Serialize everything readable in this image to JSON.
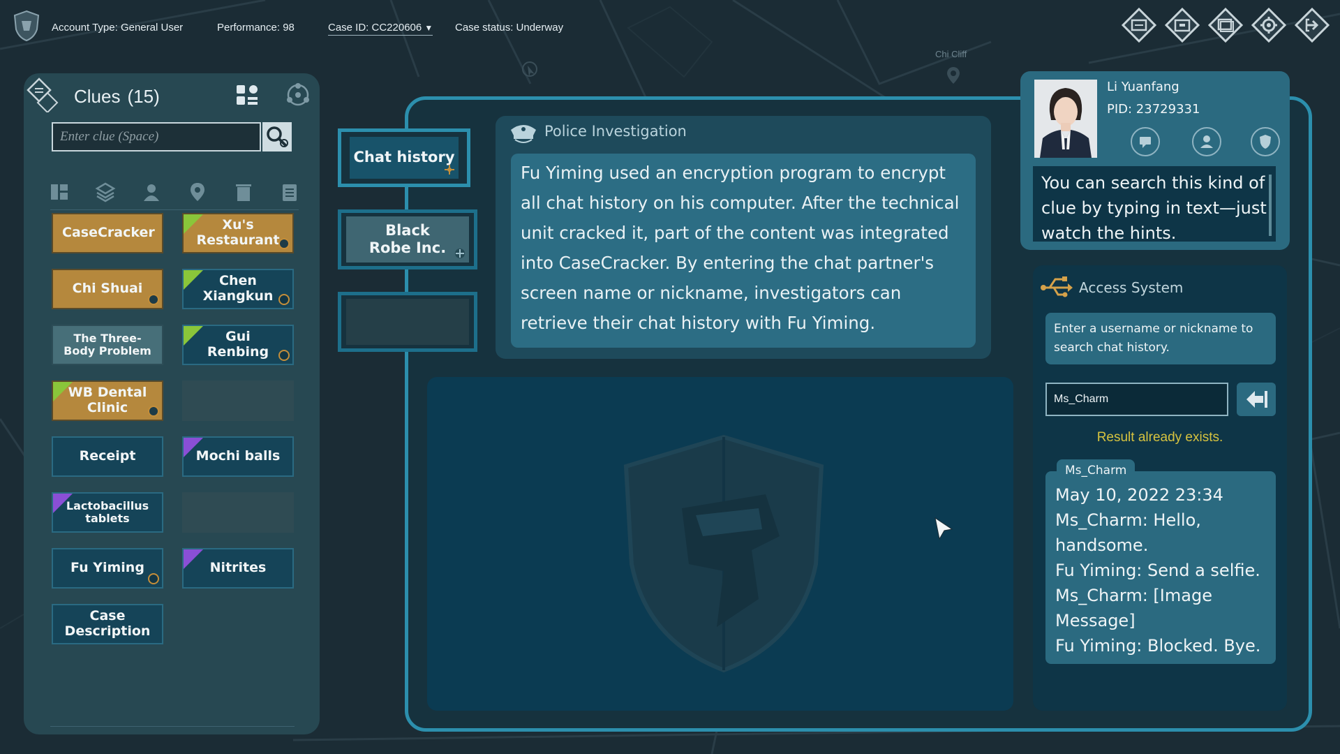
{
  "topbar": {
    "account_type": "Account Type: General User",
    "performance": "Performance: 98",
    "case_id": "Case ID: CC220606",
    "case_status": "Case status: Underway",
    "icons": [
      "case-file-icon",
      "archive-icon",
      "cards-icon",
      "settings-icon",
      "exit-icon"
    ]
  },
  "map": {
    "label": "Chi Cliff"
  },
  "clues": {
    "title": "Clues",
    "count": "(15)",
    "search_placeholder": "Enter clue (Space)",
    "filters": [
      "all-icon",
      "layers-icon",
      "person-icon",
      "location-icon",
      "trash-icon",
      "document-icon"
    ],
    "items": [
      {
        "label": "CaseCracker",
        "style": "gold",
        "flag": "",
        "badge": false
      },
      {
        "label": "Xu's Restaurant",
        "style": "gold",
        "flag": "green",
        "badge": true
      },
      {
        "label": "Chi Shuai",
        "style": "gold",
        "flag": "",
        "badge": true
      },
      {
        "label": "Chen Xiangkun",
        "style": "blue",
        "flag": "green",
        "badge": true
      },
      {
        "label": "The Three-Body Problem",
        "style": "grey",
        "flag": "",
        "badge": false
      },
      {
        "label": "Gui Renbing",
        "style": "blue",
        "flag": "green",
        "badge": true
      },
      {
        "label": "WB Dental Clinic",
        "style": "gold",
        "flag": "green",
        "badge": true
      },
      {
        "label": "",
        "style": "empty",
        "flag": "",
        "badge": false
      },
      {
        "label": "Receipt",
        "style": "blue",
        "flag": "",
        "badge": false
      },
      {
        "label": "Mochi balls",
        "style": "blue",
        "flag": "purple",
        "badge": false
      },
      {
        "label": "Lactobacillus tablets",
        "style": "blue",
        "flag": "purple",
        "badge": false
      },
      {
        "label": "",
        "style": "empty",
        "flag": "",
        "badge": false
      },
      {
        "label": "Fu Yiming",
        "style": "blue",
        "flag": "",
        "badge": true
      },
      {
        "label": "Nitrites",
        "style": "blue",
        "flag": "purple",
        "badge": false
      },
      {
        "label": "Case Description",
        "style": "blue",
        "flag": "",
        "badge": false
      }
    ]
  },
  "subtabs": {
    "chat_history": "Chat history",
    "black_robe": "Black Robe Inc."
  },
  "police": {
    "title": "Police Investigation",
    "text": "Fu Yiming used an encryption program to encrypt all chat history on his computer. After the technical unit cracked it, part of the content was integrated into CaseCracker. By entering the chat partner's screen name or nickname, investigators can retrieve their chat history with Fu Yiming."
  },
  "profile": {
    "name": "Li Yuanfang",
    "pid": "PID: 23729331",
    "hint": "You can search this kind of clue by typing in text—just watch the hints."
  },
  "access": {
    "title": "Access System",
    "description": "Enter a username or nickname to search chat history.",
    "input_value": "Ms_Charm",
    "result": "Result already exists.",
    "chat_tag": "Ms_Charm",
    "chat_lines": [
      "May 10, 2022 23:34",
      "Ms_Charm: Hello, handsome.",
      "Fu Yiming: Send a selfie.",
      "Ms_Charm: [Image Message]",
      "Fu Yiming: Blocked. Bye."
    ]
  },
  "colors": {
    "accent": "#2c8fad",
    "gold": "#b5883d",
    "result_yellow": "#d7c33f",
    "flag_green": "#8ac63a",
    "flag_purple": "#8a4fd6"
  }
}
